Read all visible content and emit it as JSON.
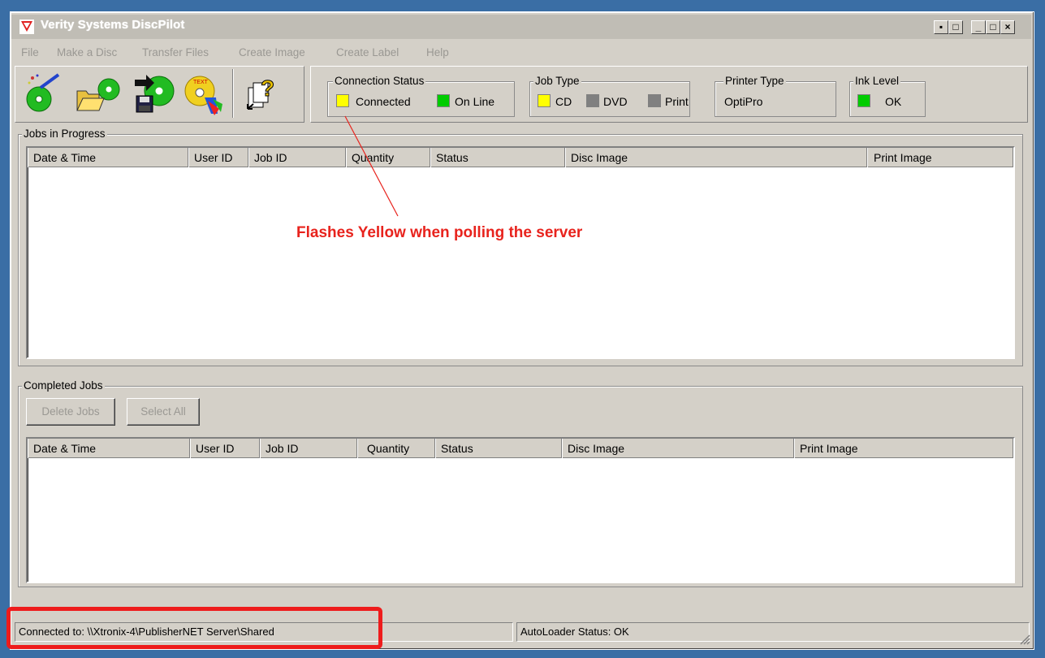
{
  "window": {
    "title": "Verity Systems DiscPilot"
  },
  "menu": [
    "File",
    "Make a Disc",
    "Transfer Files",
    "Create Image",
    "Create Label",
    "Help"
  ],
  "toolbar": {
    "icons": [
      "make-disc-icon",
      "open-folder-icon",
      "transfer-files-icon",
      "create-label-icon",
      "help-icon"
    ]
  },
  "status_groups": {
    "connection": {
      "label": "Connection Status",
      "items": [
        {
          "label": "Connected",
          "color": "#ffff00"
        },
        {
          "label": "On Line",
          "color": "#00cc00"
        }
      ]
    },
    "job_type": {
      "label": "Job Type",
      "items": [
        {
          "label": "CD",
          "color": "#ffff00"
        },
        {
          "label": "DVD",
          "color": "#808080"
        },
        {
          "label": "Print",
          "color": "#808080"
        }
      ]
    },
    "printer_type": {
      "label": "Printer Type",
      "value": "OptiPro"
    },
    "ink_level": {
      "label": "Ink Level",
      "value": "OK",
      "color": "#00cc00"
    }
  },
  "jobs_in_progress": {
    "label": "Jobs in Progress",
    "columns": [
      "Date & Time",
      "User ID",
      "Job ID",
      "Quantity",
      "Status",
      "Disc Image",
      "Print Image"
    ],
    "rows": []
  },
  "completed_jobs": {
    "label": "Completed Jobs",
    "delete_label": "Delete Jobs",
    "select_all_label": "Select All",
    "columns": [
      "Date & Time",
      "User ID",
      "Job ID",
      "Quantity",
      "Status",
      "Disc Image",
      "Print Image"
    ],
    "rows": []
  },
  "statusbar": {
    "connected_to": "Connected to: \\\\Xtronix-4\\PublisherNET Server\\Shared",
    "autoloader": "AutoLoader Status: OK"
  },
  "annotation": {
    "text": "Flashes Yellow when polling the server",
    "color": "#e8231d"
  }
}
